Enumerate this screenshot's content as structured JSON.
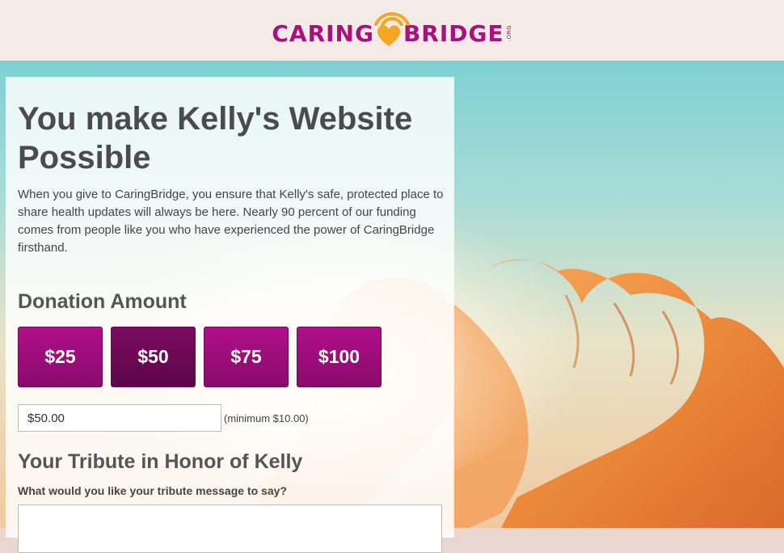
{
  "header": {
    "logo_left": "CARING",
    "logo_right": "BRIDGE",
    "logo_suffix": ".ORG"
  },
  "main": {
    "title": "You make Kelly's Website Possible",
    "intro": "When you give to CaringBridge, you ensure that Kelly's safe, protected place to share health updates will always be here. Nearly 90 percent of our funding comes from people like you who have experienced the power of CaringBridge firsthand.",
    "donation_heading": "Donation Amount",
    "amounts": [
      {
        "label": "$25",
        "selected": false
      },
      {
        "label": "$50",
        "selected": true
      },
      {
        "label": "$75",
        "selected": false
      },
      {
        "label": "$100",
        "selected": false
      }
    ],
    "amount_value": "$50.00",
    "minimum_note": "(minimum $10.00)",
    "tribute_heading": "Your Tribute in Honor of Kelly",
    "tribute_label": "What would you like your tribute message to say?",
    "tribute_value": ""
  },
  "colors": {
    "brand": "#a8117e",
    "button": "#9c0c7b",
    "button_selected": "#6b0854",
    "heart": "#f5a623"
  },
  "icons": {
    "logo": "caringbridge-heart-logo",
    "background": "heart-hands-photo"
  }
}
